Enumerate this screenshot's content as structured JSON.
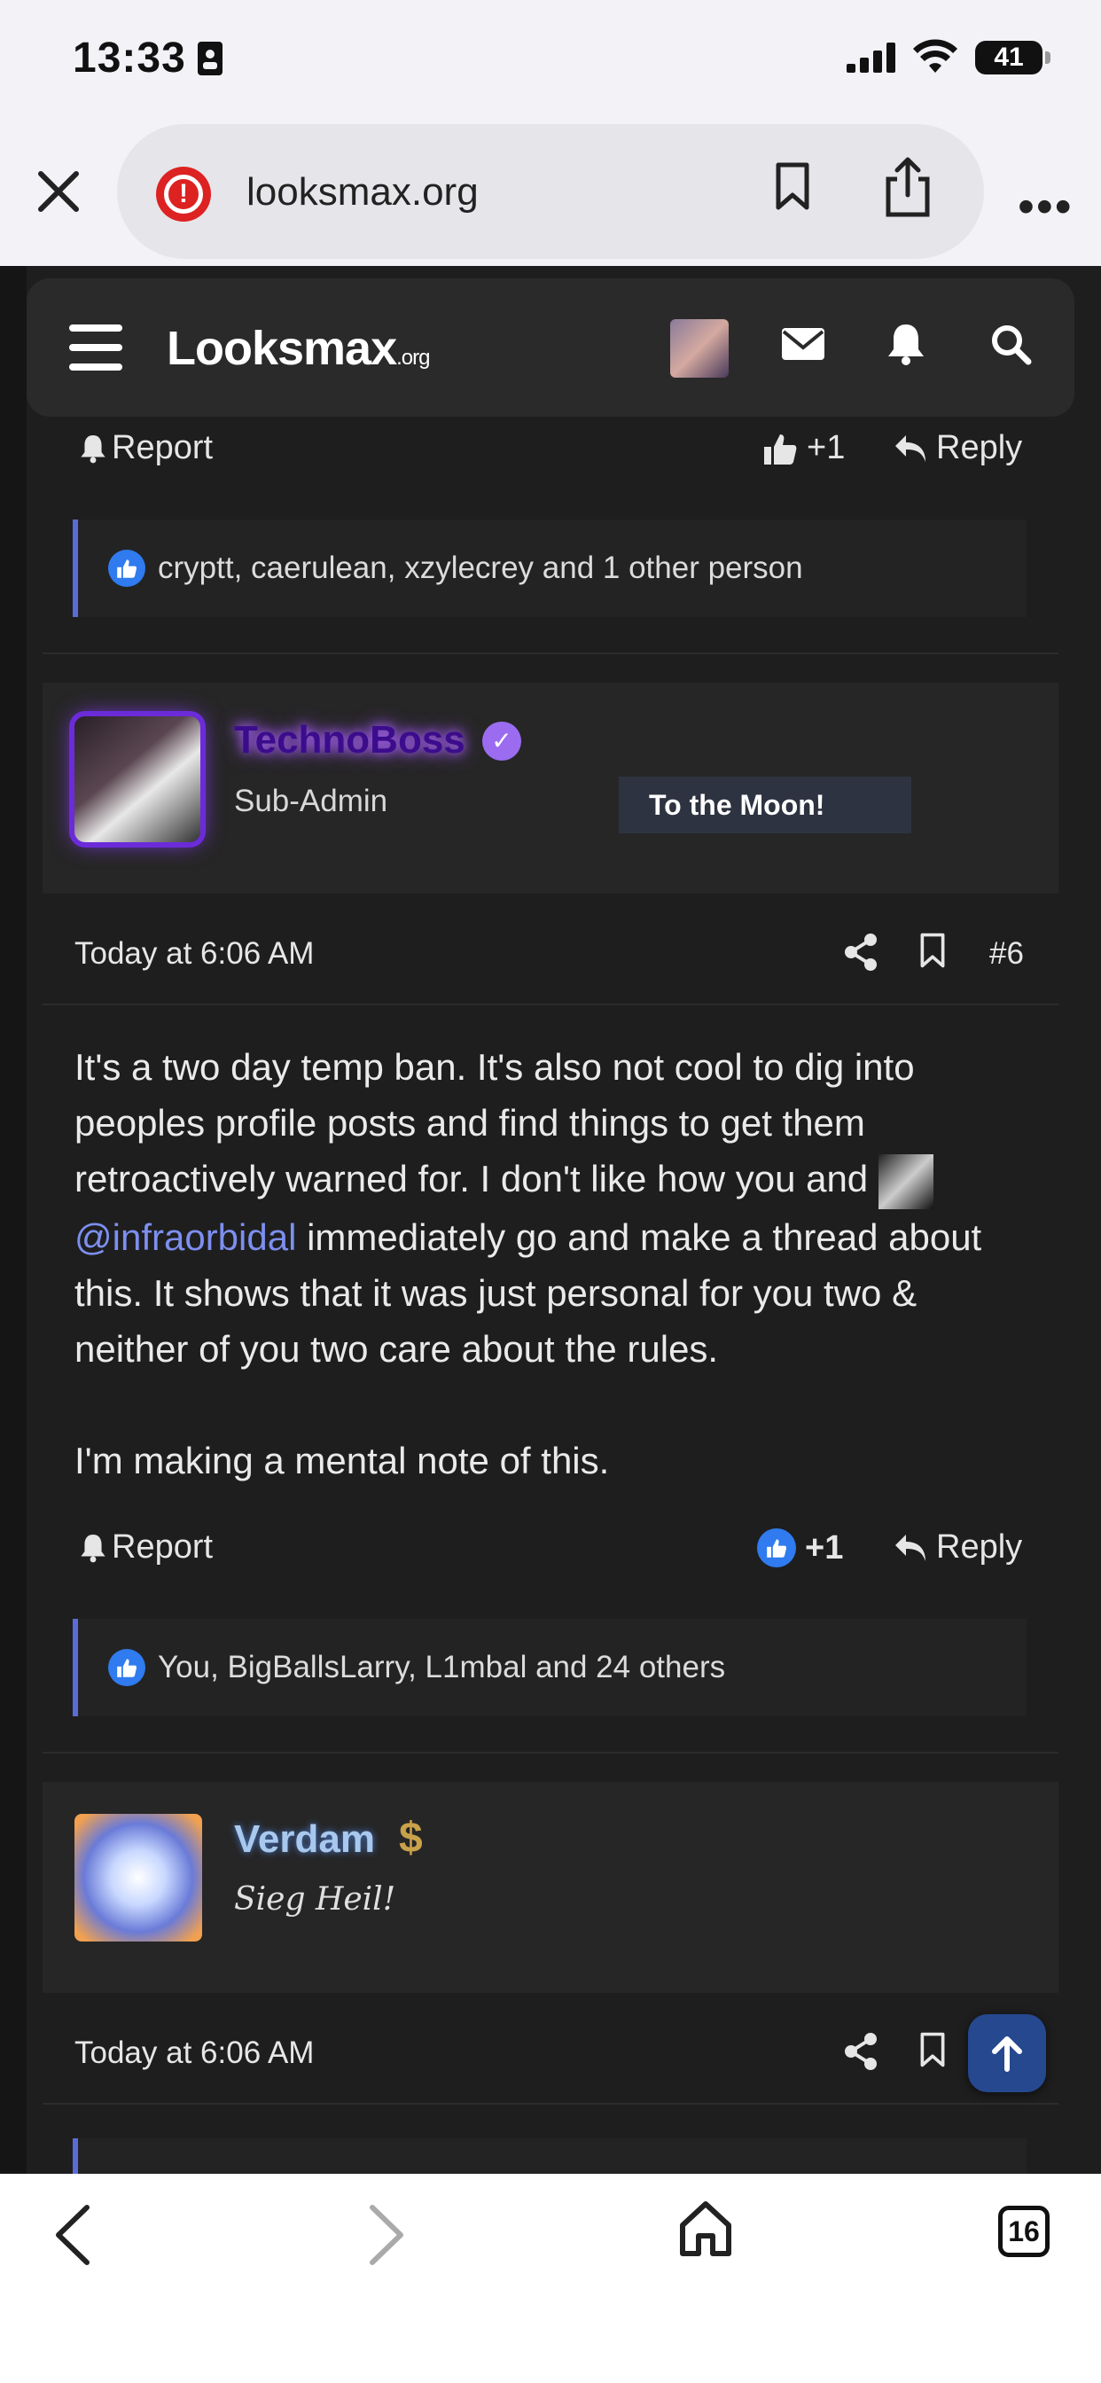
{
  "status": {
    "time": "13:33",
    "battery": "41"
  },
  "browser": {
    "url": "looksmax.org",
    "tab_count": "16"
  },
  "site": {
    "logo_main": "Looksmax",
    "logo_suffix": ".org"
  },
  "prev_post": {
    "report_label": "Report",
    "like_count": "+1",
    "reply_label": "Reply",
    "reactions": "cryptt, caerulean, xzylecrey and 1 other person"
  },
  "post1": {
    "username": "TechnoBoss",
    "user_title": "Sub-Admin",
    "banner": "To the Moon!",
    "date": "Today at 6:06 AM",
    "number": "#6",
    "body_p1_a": "It's a two day temp ban. It's also not cool to dig into peoples profile posts and find things to get them retroactively warned for. I don't like how you and ",
    "mention": "@infraorbidal",
    "body_p1_b": " immediately go and make a thread about this. It shows that it was just personal for you two & neither of you two care about the rules.",
    "body_p2": "I'm making a mental note of this.",
    "report_label": "Report",
    "like_count": "+1",
    "reply_label": "Reply",
    "reactions": "You, BigBallsLarry, L1mbal and 24 others"
  },
  "post2": {
    "username": "Verdam",
    "badge": "$",
    "user_title": "Sieg Heil!",
    "date": "Today at 6:06 AM"
  }
}
